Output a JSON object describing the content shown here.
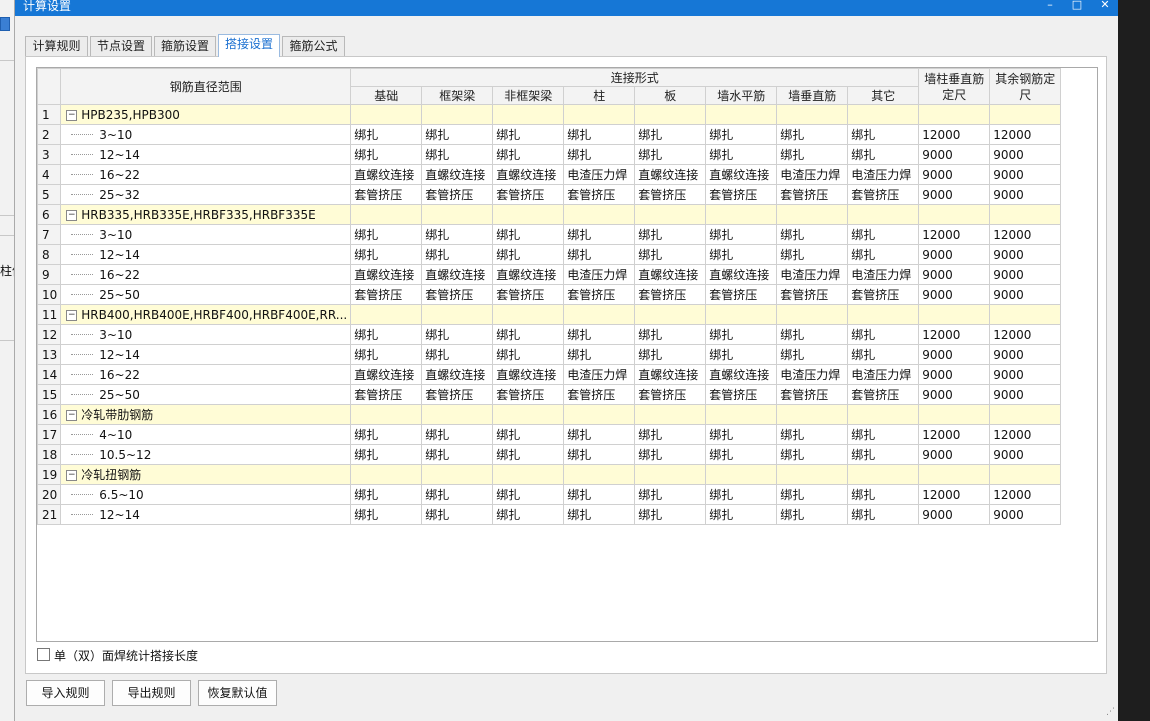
{
  "window": {
    "title": "计算设置",
    "controls": {
      "minimize": "–",
      "maximize": "□",
      "close": "✕"
    }
  },
  "background_app": {
    "partial_label": "柱值"
  },
  "tabs": [
    {
      "label": "计算规则"
    },
    {
      "label": "节点设置"
    },
    {
      "label": "箍筋设置"
    },
    {
      "label": "搭接设置",
      "active": true
    },
    {
      "label": "箍筋公式"
    }
  ],
  "grid": {
    "headers": {
      "range": "钢筋直径范围",
      "connection_group": "连接形式",
      "connection_columns": [
        "基础",
        "框架梁",
        "非框架梁",
        "柱",
        "板",
        "墙水平筋",
        "墙垂直筋",
        "其它"
      ],
      "wall_col_length": "墙柱垂直筋定尺",
      "other_length": "其余钢筋定尺"
    },
    "rows": [
      {
        "n": "1",
        "type": "group",
        "label": "HPB235,HPB300"
      },
      {
        "n": "2",
        "type": "item",
        "label": "3~10",
        "conn": [
          "绑扎",
          "绑扎",
          "绑扎",
          "绑扎",
          "绑扎",
          "绑扎",
          "绑扎",
          "绑扎"
        ],
        "wall": "12000",
        "other": "12000"
      },
      {
        "n": "3",
        "type": "item",
        "label": "12~14",
        "conn": [
          "绑扎",
          "绑扎",
          "绑扎",
          "绑扎",
          "绑扎",
          "绑扎",
          "绑扎",
          "绑扎"
        ],
        "wall": "9000",
        "other": "9000"
      },
      {
        "n": "4",
        "type": "item",
        "label": "16~22",
        "conn": [
          "直螺纹连接",
          "直螺纹连接",
          "直螺纹连接",
          "电渣压力焊",
          "直螺纹连接",
          "直螺纹连接",
          "电渣压力焊",
          "电渣压力焊"
        ],
        "wall": "9000",
        "other": "9000"
      },
      {
        "n": "5",
        "type": "item",
        "label": "25~32",
        "conn": [
          "套管挤压",
          "套管挤压",
          "套管挤压",
          "套管挤压",
          "套管挤压",
          "套管挤压",
          "套管挤压",
          "套管挤压"
        ],
        "wall": "9000",
        "other": "9000"
      },
      {
        "n": "6",
        "type": "group",
        "label": "HRB335,HRB335E,HRBF335,HRBF335E"
      },
      {
        "n": "7",
        "type": "item",
        "label": "3~10",
        "conn": [
          "绑扎",
          "绑扎",
          "绑扎",
          "绑扎",
          "绑扎",
          "绑扎",
          "绑扎",
          "绑扎"
        ],
        "wall": "12000",
        "other": "12000"
      },
      {
        "n": "8",
        "type": "item",
        "label": "12~14",
        "conn": [
          "绑扎",
          "绑扎",
          "绑扎",
          "绑扎",
          "绑扎",
          "绑扎",
          "绑扎",
          "绑扎"
        ],
        "wall": "9000",
        "other": "9000"
      },
      {
        "n": "9",
        "type": "item",
        "label": "16~22",
        "conn": [
          "直螺纹连接",
          "直螺纹连接",
          "直螺纹连接",
          "电渣压力焊",
          "直螺纹连接",
          "直螺纹连接",
          "电渣压力焊",
          "电渣压力焊"
        ],
        "wall": "9000",
        "other": "9000"
      },
      {
        "n": "10",
        "type": "item",
        "label": "25~50",
        "conn": [
          "套管挤压",
          "套管挤压",
          "套管挤压",
          "套管挤压",
          "套管挤压",
          "套管挤压",
          "套管挤压",
          "套管挤压"
        ],
        "wall": "9000",
        "other": "9000"
      },
      {
        "n": "11",
        "type": "group",
        "label": "HRB400,HRB400E,HRBF400,HRBF400E,RR..."
      },
      {
        "n": "12",
        "type": "item",
        "label": "3~10",
        "conn": [
          "绑扎",
          "绑扎",
          "绑扎",
          "绑扎",
          "绑扎",
          "绑扎",
          "绑扎",
          "绑扎"
        ],
        "wall": "12000",
        "other": "12000"
      },
      {
        "n": "13",
        "type": "item",
        "label": "12~14",
        "conn": [
          "绑扎",
          "绑扎",
          "绑扎",
          "绑扎",
          "绑扎",
          "绑扎",
          "绑扎",
          "绑扎"
        ],
        "wall": "9000",
        "other": "9000"
      },
      {
        "n": "14",
        "type": "item",
        "label": "16~22",
        "conn": [
          "直螺纹连接",
          "直螺纹连接",
          "直螺纹连接",
          "电渣压力焊",
          "直螺纹连接",
          "直螺纹连接",
          "电渣压力焊",
          "电渣压力焊"
        ],
        "wall": "9000",
        "other": "9000"
      },
      {
        "n": "15",
        "type": "item",
        "label": "25~50",
        "conn": [
          "套管挤压",
          "套管挤压",
          "套管挤压",
          "套管挤压",
          "套管挤压",
          "套管挤压",
          "套管挤压",
          "套管挤压"
        ],
        "wall": "9000",
        "other": "9000"
      },
      {
        "n": "16",
        "type": "group",
        "label": "冷轧带肋钢筋"
      },
      {
        "n": "17",
        "type": "item",
        "label": "4~10",
        "conn": [
          "绑扎",
          "绑扎",
          "绑扎",
          "绑扎",
          "绑扎",
          "绑扎",
          "绑扎",
          "绑扎"
        ],
        "wall": "12000",
        "other": "12000"
      },
      {
        "n": "18",
        "type": "item",
        "label": "10.5~12",
        "conn": [
          "绑扎",
          "绑扎",
          "绑扎",
          "绑扎",
          "绑扎",
          "绑扎",
          "绑扎",
          "绑扎"
        ],
        "wall": "9000",
        "other": "9000"
      },
      {
        "n": "19",
        "type": "group",
        "label": "冷轧扭钢筋"
      },
      {
        "n": "20",
        "type": "item",
        "label": "6.5~10",
        "conn": [
          "绑扎",
          "绑扎",
          "绑扎",
          "绑扎",
          "绑扎",
          "绑扎",
          "绑扎",
          "绑扎"
        ],
        "wall": "12000",
        "other": "12000"
      },
      {
        "n": "21",
        "type": "item",
        "label": "12~14",
        "conn": [
          "绑扎",
          "绑扎",
          "绑扎",
          "绑扎",
          "绑扎",
          "绑扎",
          "绑扎",
          "绑扎"
        ],
        "wall": "9000",
        "other": "9000"
      }
    ]
  },
  "options": {
    "weld_checkbox_label": "单（双）面焊统计搭接长度",
    "weld_checked": false
  },
  "buttons": {
    "import": "导入规则",
    "export": "导出规则",
    "restore": "恢复默认值"
  },
  "colors": {
    "titlebar": "#1677d6",
    "group_row": "#fffcd6",
    "active_tab_text": "#1a6fd0"
  }
}
